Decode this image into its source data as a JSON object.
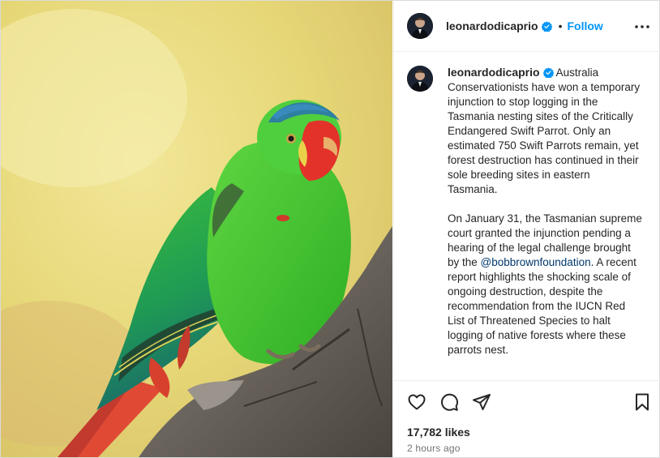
{
  "post": {
    "username": "leonardodicaprio",
    "follow_label": "Follow",
    "dot": "•",
    "caption": {
      "username": "leonardodicaprio",
      "paragraph1": "Australia Conservationists have won a temporary injunction to stop logging in the Tasmania nesting sites of the Critically Endangered Swift Parrot. Only an estimated 750 Swift Parrots remain, yet forest destruction has continued in their sole breeding sites in eastern Tasmania.",
      "paragraph2_before": "On January 31, the Tasmanian supreme court granted the injunction pending a hearing of the legal challenge brought by the ",
      "mention": "@bobbrownfoundation",
      "paragraph2_after": ". A recent report highlights the shocking scale of ongoing destruction, despite the recommendation from the IUCN Red List of Threatened Species to halt logging of native forests where these parrots nest."
    },
    "likes": "17,782 likes",
    "time": "2 hours ago"
  },
  "icons": {
    "verified": "verified-badge-icon",
    "more": "more-options-icon",
    "like": "heart-icon",
    "comment": "comment-icon",
    "share": "share-icon",
    "save": "bookmark-icon"
  },
  "colors": {
    "accent": "#0095f6",
    "mention": "#00376b",
    "text": "#262626",
    "muted": "#737373",
    "border": "#dbdbdb"
  }
}
